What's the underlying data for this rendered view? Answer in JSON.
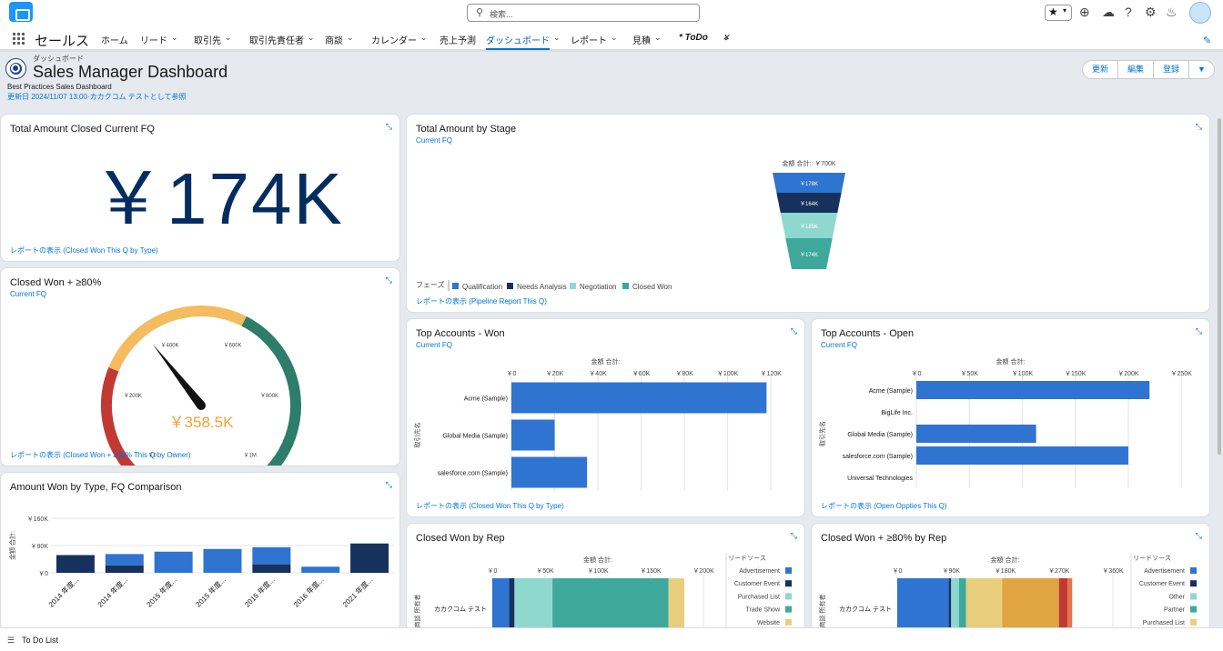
{
  "search": {
    "placeholder": "検索..."
  },
  "app": {
    "name": "セールス"
  },
  "nav": {
    "tabs": [
      {
        "label": "ホーム",
        "chev": false
      },
      {
        "label": "リード",
        "chev": true
      },
      {
        "label": "取引先",
        "chev": true
      },
      {
        "label": "取引先責任者",
        "chev": true
      },
      {
        "label": "商談",
        "chev": true
      },
      {
        "label": "カレンダー",
        "chev": true
      },
      {
        "label": "売上予測",
        "chev": false
      },
      {
        "label": "ダッシュボード",
        "chev": true,
        "active": true
      },
      {
        "label": "レポート",
        "chev": true
      },
      {
        "label": "見積",
        "chev": true
      },
      {
        "label": "* ToDo",
        "chev": true,
        "close": true
      }
    ]
  },
  "header": {
    "small": "ダッシュボード",
    "title": "Sales Manager Dashboard",
    "subtitle": "Best Practices Sales Dashboard",
    "updated": "更新日 2024/11/07 13:00·カカクコム テストとして参照",
    "buttons": [
      "更新",
      "編集",
      "登録"
    ]
  },
  "cards": {
    "total_amount": {
      "title": "Total Amount Closed Current FQ",
      "value": "￥174K",
      "report": "レポートの表示 (Closed Won This Q by Type)"
    },
    "closed_won80": {
      "title": "Closed Won + ≥80%",
      "subtitle": "Current FQ",
      "value": "￥358.5K",
      "report": "レポートの表示 (Closed Won + ≥80% This Q by Owner)"
    },
    "amount_won_type": {
      "title": "Amount Won by Type, FQ Comparison"
    },
    "by_stage": {
      "title": "Total Amount by Stage",
      "subtitle": "Current FQ",
      "total": "金額 合計:: ￥700K",
      "legend_label": "フェーズ",
      "report": "レポートの表示 (Pipeline Report This Q)"
    },
    "top_won": {
      "title": "Top Accounts - Won",
      "subtitle": "Current FQ",
      "report": "レポートの表示 (Closed Won This Q by Type)"
    },
    "top_open": {
      "title": "Top Accounts - Open",
      "subtitle": "Current FQ",
      "report": "レポートの表示 (Open Oppties This Q)"
    },
    "won_rep": {
      "title": "Closed Won by Rep"
    },
    "won80_rep": {
      "title": "Closed Won + ≥80% by Rep"
    }
  },
  "footer": {
    "label": "To Do List"
  },
  "chart_data": [
    {
      "id": "gauge",
      "type": "gauge",
      "min": 0,
      "max": 1000,
      "value": 358.5,
      "tick_labels": [
        "￥0",
        "￥200K",
        "￥400K",
        "￥600K",
        "￥800K",
        "￥1M"
      ],
      "value_label": "￥358.5K",
      "bands": [
        {
          "to": 250,
          "color": "#c23934"
        },
        {
          "to": 600,
          "color": "#f4bc5e"
        },
        {
          "to": 1000,
          "color": "#2e7d6b"
        }
      ]
    },
    {
      "id": "type_comparison",
      "type": "bar",
      "ylabel": "金額 合計:",
      "yticks": [
        "￥0",
        "￥80K",
        "￥160K"
      ],
      "ylim": [
        0,
        160
      ],
      "categories": [
        "2014 年度...",
        "2014 年度...",
        "2015 年度...",
        "2015 年度...",
        "2015 年度...",
        "2016 年度...",
        "2021 年度..."
      ],
      "bars": [
        {
          "segments": [
            {
              "value": 52,
              "color": "#16325c"
            }
          ]
        },
        {
          "segments": [
            {
              "value": 22,
              "color": "#16325c"
            },
            {
              "value": 33,
              "color": "#2f74d0"
            }
          ]
        },
        {
          "segments": [
            {
              "value": 62,
              "color": "#2f74d0"
            }
          ]
        },
        {
          "segments": [
            {
              "value": 70,
              "color": "#2f74d0"
            }
          ]
        },
        {
          "segments": [
            {
              "value": 25,
              "color": "#16325c"
            },
            {
              "value": 50,
              "color": "#2f74d0"
            }
          ]
        },
        {
          "segments": [
            {
              "value": 18,
              "color": "#2f74d0"
            }
          ]
        },
        {
          "segments": [
            {
              "value": 86,
              "color": "#16325c"
            }
          ]
        }
      ]
    },
    {
      "id": "stage_funnel",
      "type": "funnel",
      "legend_title": "フェーズ",
      "series": [
        {
          "name": "Qualification",
          "value": 178,
          "label": "￥178K",
          "color": "#2f74d0"
        },
        {
          "name": "Needs Analysis",
          "value": 164,
          "label": "￥164K",
          "color": "#16325c"
        },
        {
          "name": "Negotiation",
          "value": 185,
          "label": "￥185K",
          "color": "#8fd8d0"
        },
        {
          "name": "Closed Won",
          "value": 174,
          "label": "￥174K",
          "color": "#3ea89c"
        }
      ]
    },
    {
      "id": "top_won_chart",
      "type": "bar",
      "orientation": "horizontal",
      "xlabel": "金額 合計:",
      "ylabel": "取引先名",
      "xticks": [
        "￥0",
        "￥20K",
        "￥40K",
        "￥60K",
        "￥80K",
        "￥100K",
        "￥120K"
      ],
      "xlim": [
        0,
        125
      ],
      "categories": [
        "Acme (Sample)",
        "Global Media (Sample)",
        "salesforce.com (Sample)"
      ],
      "values": [
        118,
        20,
        35
      ],
      "color": "#2f74d0"
    },
    {
      "id": "top_open_chart",
      "type": "bar",
      "orientation": "horizontal",
      "xlabel": "金額 合計:",
      "ylabel": "取引先名",
      "xticks": [
        "￥0",
        "￥50K",
        "￥100K",
        "￥150K",
        "￥200K",
        "￥250K"
      ],
      "xlim": [
        0,
        255
      ],
      "categories": [
        "Acme (Sample)",
        "BigLife Inc.",
        "Global Media (Sample)",
        "salesforce.com (Sample)",
        "Universal Technologies"
      ],
      "values": [
        220,
        0,
        113,
        200,
        0
      ],
      "color": "#2f74d0"
    },
    {
      "id": "won_by_rep",
      "type": "bar",
      "orientation": "horizontal",
      "stacked": true,
      "xlabel": "金額 合計:",
      "ylabel": "商談 所有者",
      "legend_title": "リードソース",
      "xticks": [
        "￥0",
        "￥50K",
        "￥100K",
        "￥150K",
        "￥200K"
      ],
      "xlim": [
        0,
        200
      ],
      "categories": [
        "カカクコム テスト"
      ],
      "segments": [
        {
          "value": 16,
          "color": "#2f74d0"
        },
        {
          "value": 5,
          "color": "#16325c"
        },
        {
          "value": 36,
          "color": "#8fd8d0"
        },
        {
          "value": 110,
          "color": "#3ea89c"
        },
        {
          "value": 15,
          "color": "#e9cf7d"
        }
      ],
      "legend": [
        {
          "name": "Advertisement",
          "color": "#2f74d0"
        },
        {
          "name": "Customer Event",
          "color": "#16325c"
        },
        {
          "name": "Purchased List",
          "color": "#8fd8d0"
        },
        {
          "name": "Trade Show",
          "color": "#3ea89c"
        },
        {
          "name": "Website",
          "color": "#e9cf7d"
        }
      ]
    },
    {
      "id": "won80_by_rep",
      "type": "bar",
      "orientation": "horizontal",
      "stacked": true,
      "xlabel": "金額 合計:",
      "ylabel": "商談 所有者",
      "legend_title": "リードソース",
      "xticks": [
        "￥0",
        "￥90K",
        "￥180K",
        "￥270K",
        "￥360K"
      ],
      "xlim": [
        0,
        360
      ],
      "categories": [
        "カカクコム テスト"
      ],
      "segments": [
        {
          "value": 86,
          "color": "#2f74d0"
        },
        {
          "value": 4,
          "color": "#16325c"
        },
        {
          "value": 13,
          "color": "#8fd8d0"
        },
        {
          "value": 12,
          "color": "#3ea89c"
        },
        {
          "value": 60,
          "color": "#e9cf7d"
        },
        {
          "value": 95,
          "color": "#e0a540"
        },
        {
          "value": 14,
          "color": "#c23934"
        },
        {
          "value": 8,
          "color": "#e2754a"
        }
      ],
      "legend": [
        {
          "name": "Advertisement",
          "color": "#2f74d0"
        },
        {
          "name": "Customer Event",
          "color": "#16325c"
        },
        {
          "name": "Other",
          "color": "#8fd8d0"
        },
        {
          "name": "Partner",
          "color": "#3ea89c"
        },
        {
          "name": "Purchased List",
          "color": "#e9cf7d"
        }
      ]
    }
  ]
}
